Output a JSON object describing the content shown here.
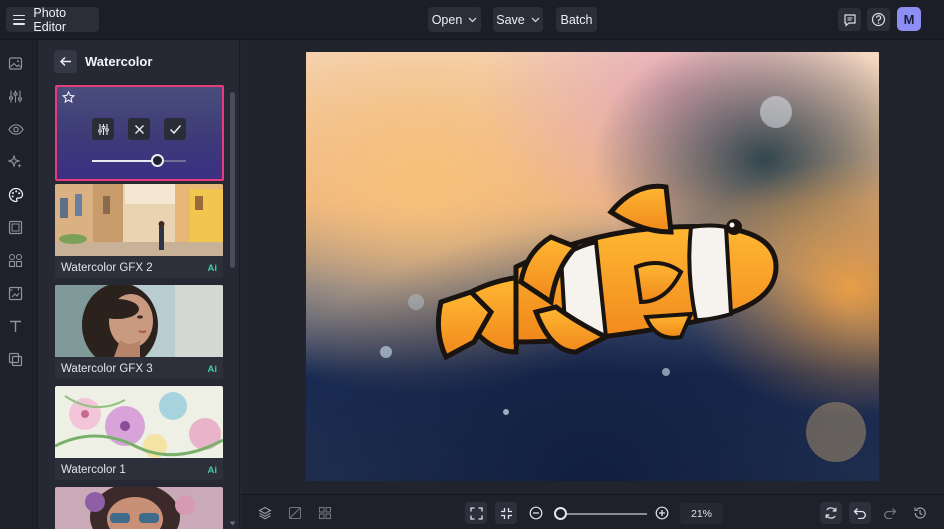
{
  "header": {
    "app_title": "Photo Editor",
    "open_label": "Open",
    "save_label": "Save",
    "batch_label": "Batch",
    "avatar_initial": "M"
  },
  "rail": {
    "icons": [
      "image-icon",
      "adjustments-icon",
      "eye-icon",
      "sparkle-icon",
      "palette-icon",
      "frame-icon",
      "shapes-icon",
      "texture-icon",
      "text-icon",
      "overlay-icon"
    ]
  },
  "panel": {
    "title": "Watercolor",
    "active_effect": {
      "favorite": false,
      "intensity": 0.7
    },
    "effects": [
      {
        "label": "Watercolor GFX 2",
        "badge": "Ai"
      },
      {
        "label": "Watercolor GFX 3",
        "badge": "Ai"
      },
      {
        "label": "Watercolor 1",
        "badge": "Ai"
      }
    ]
  },
  "bottom": {
    "zoom_label": "21%",
    "zoom_value": 0.02
  },
  "colors": {
    "accent_border": "#e63b7d",
    "ai_badge": "#3fd0a2",
    "avatar": "#8d8ff5"
  }
}
